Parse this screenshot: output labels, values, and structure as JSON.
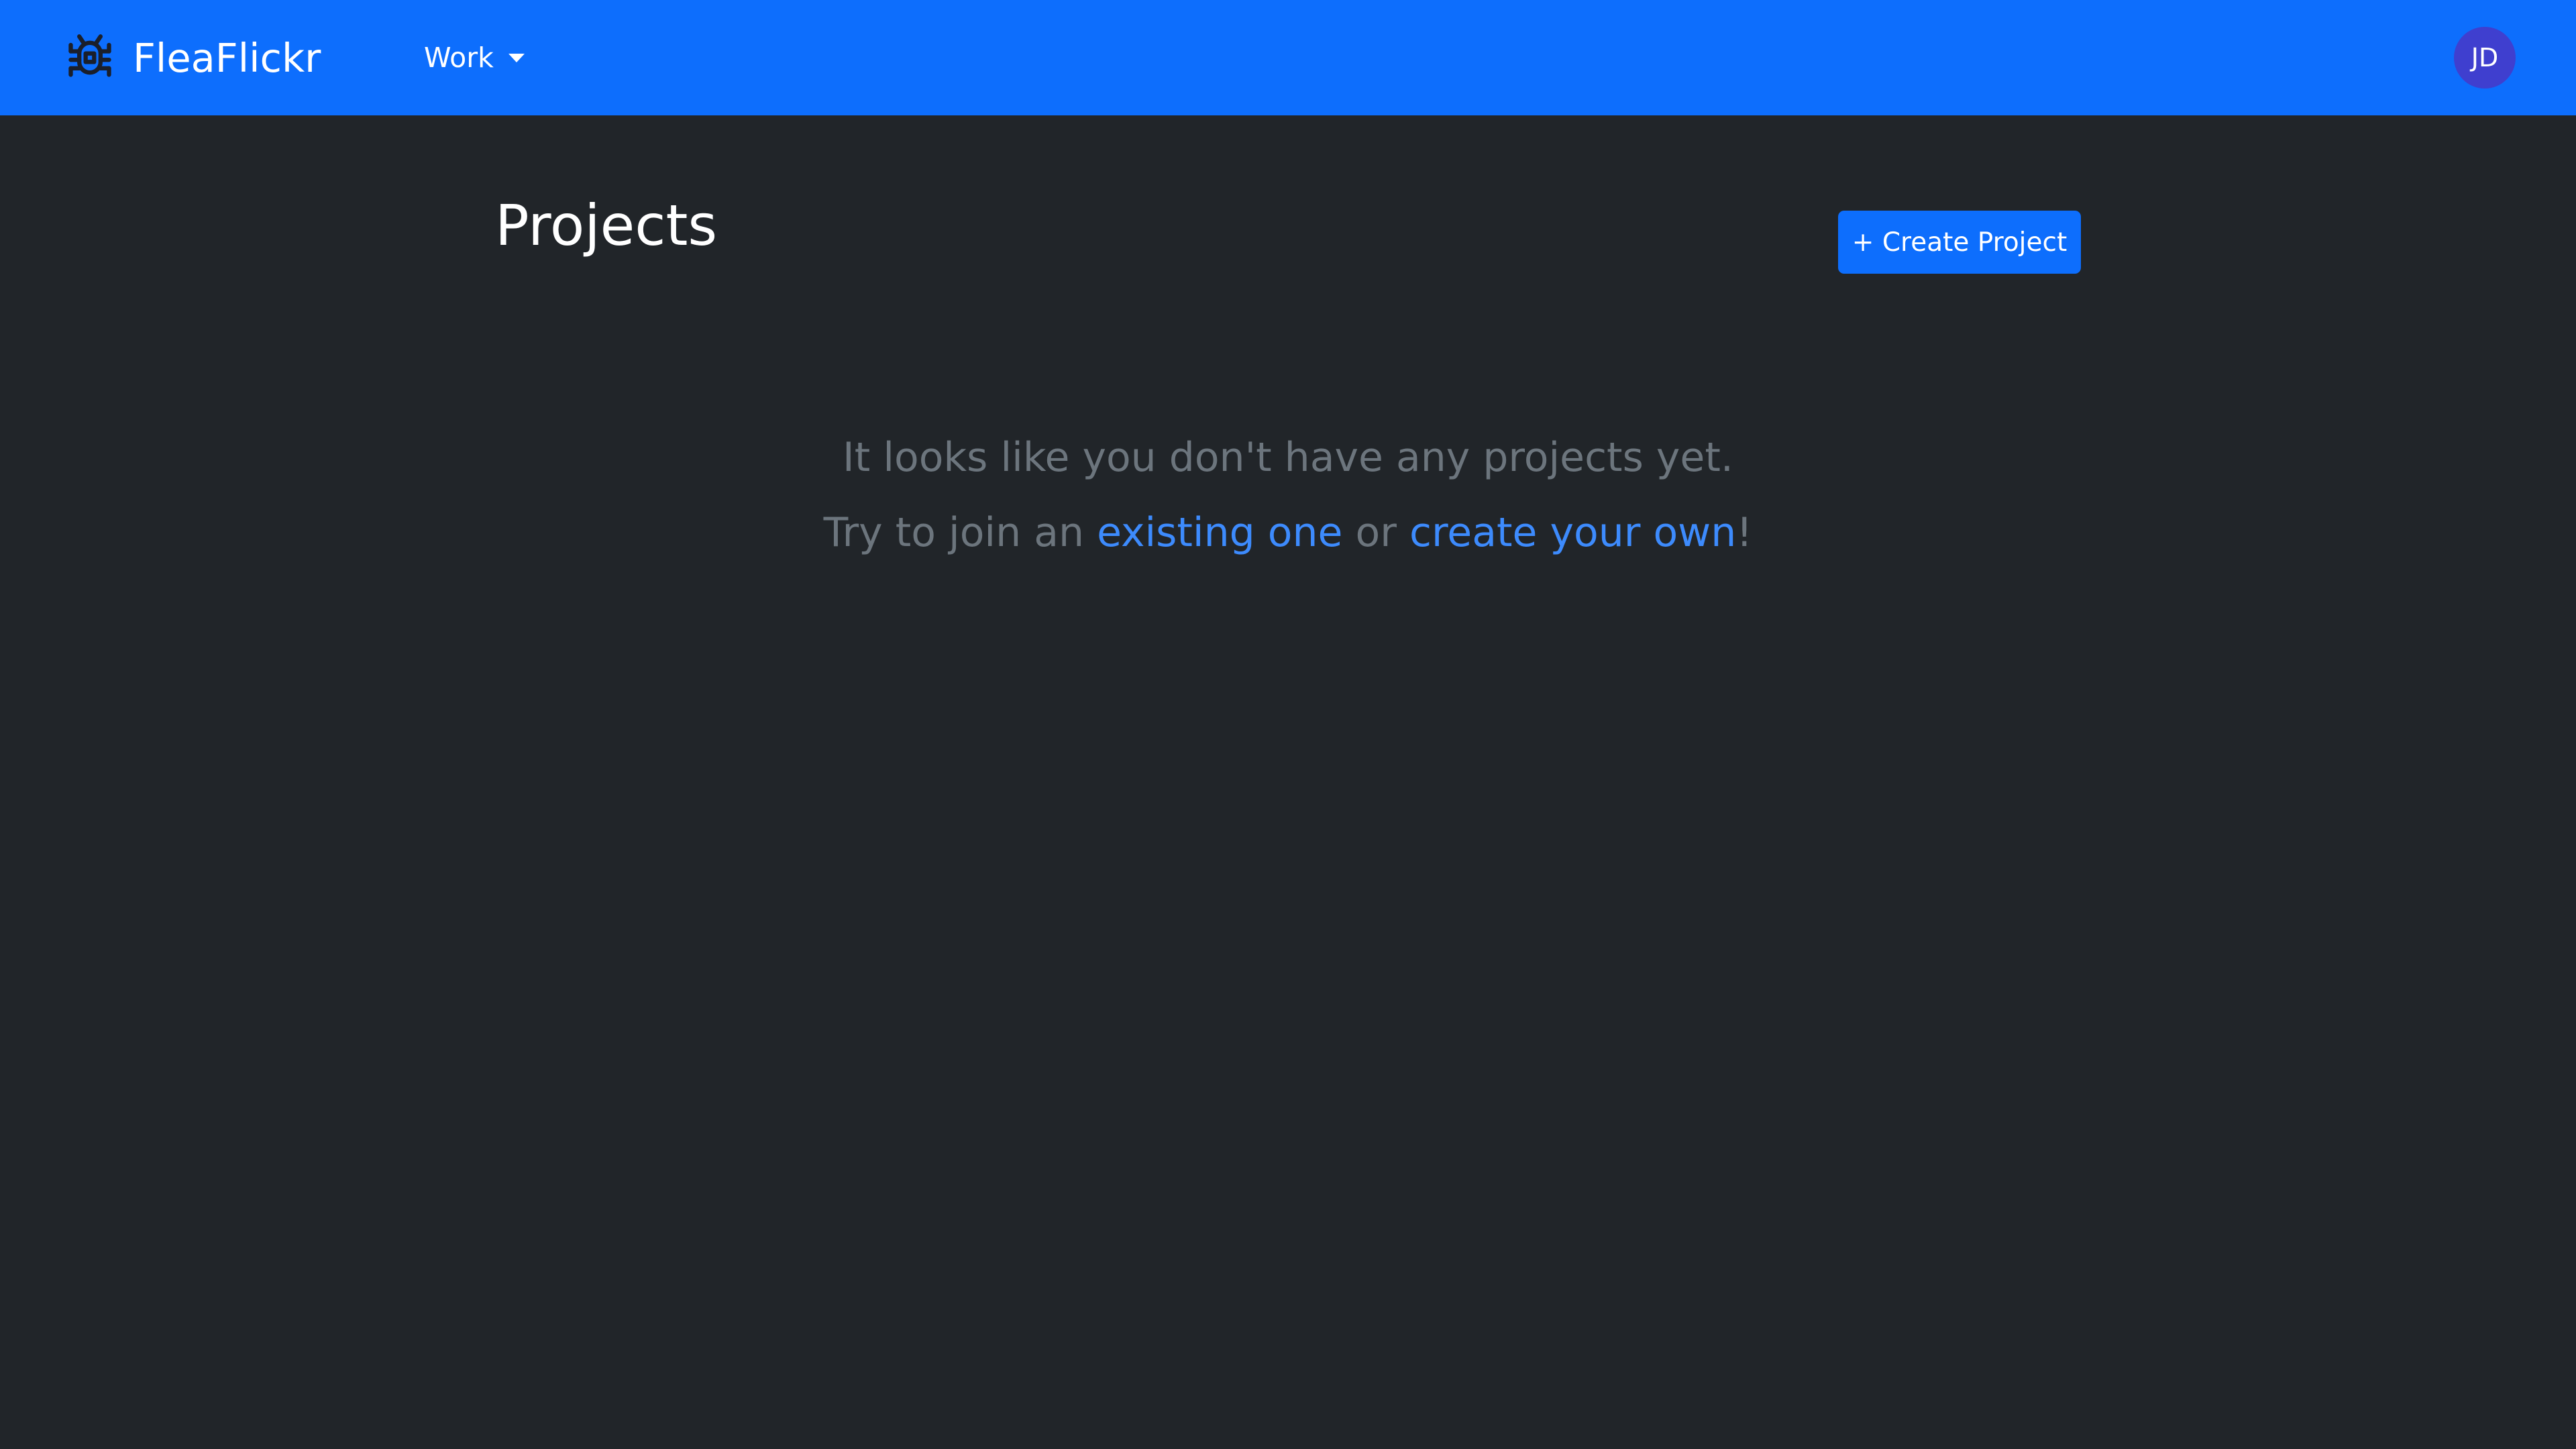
{
  "navbar": {
    "brand_name": "FleaFlickr",
    "brand_icon": "bug-icon",
    "workspace_label": "Work",
    "avatar_initials": "JD",
    "background_color": "#0d6efd"
  },
  "main": {
    "title": "Projects",
    "create_button_label": "+ Create Project",
    "empty_state": {
      "message": "It looks like you don't have any projects yet.",
      "prompt_prefix": "Try to join an",
      "join_link": "existing one",
      "prompt_middle": "or",
      "create_link": "create your own",
      "prompt_suffix": "!"
    }
  },
  "colors": {
    "page_background": "#212529",
    "accent": "#0d6efd",
    "muted_text": "#6c757d",
    "link": "#3d8bfd",
    "avatar_background": "#3f3fcf"
  }
}
